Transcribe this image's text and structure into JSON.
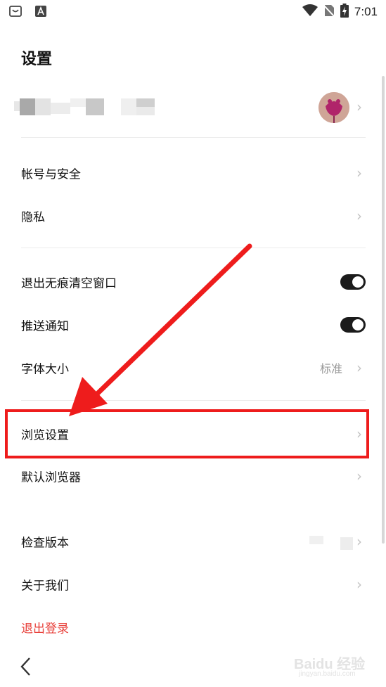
{
  "status_bar": {
    "time": "7:01"
  },
  "header": {
    "title": "设置"
  },
  "sections": {
    "account": [
      {
        "label": "帐号与安全"
      },
      {
        "label": "隐私"
      }
    ],
    "general": [
      {
        "label": "退出无痕清空窗口",
        "toggle_on": true
      },
      {
        "label": "推送通知",
        "toggle_on": true
      },
      {
        "label": "字体大小",
        "value": "标准"
      }
    ],
    "browse": [
      {
        "label": "浏览设置"
      },
      {
        "label": "默认浏览器"
      }
    ],
    "about": [
      {
        "label": "检查版本"
      },
      {
        "label": "关于我们"
      }
    ],
    "logout": {
      "label": "退出登录"
    }
  },
  "colors": {
    "accent_red": "#e8423c",
    "highlight_red": "#ee1c1c",
    "toggle_dark": "#1b1b1b"
  },
  "icons": [
    "store-icon",
    "font-a-icon",
    "wifi-icon",
    "no-sim-icon",
    "battery-charging-icon",
    "chevron-right-icon",
    "back-arrow-icon"
  ]
}
